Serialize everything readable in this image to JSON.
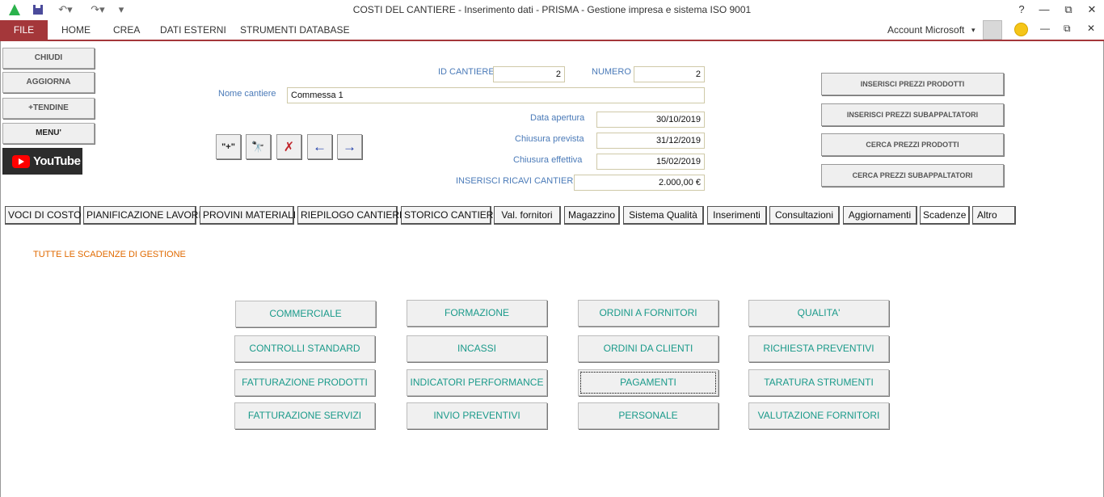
{
  "window": {
    "title": "COSTI DEL CANTIERE - Inserimento dati - PRISMA - Gestione impresa e sistema ISO 9001",
    "help": "?",
    "restore": "⧉",
    "minimize": "—",
    "close": "✕"
  },
  "ribbon": {
    "file": "FILE",
    "tabs": [
      "HOME",
      "CREA",
      "DATI ESTERNI",
      "STRUMENTI DATABASE"
    ],
    "account": "Account Microsoft"
  },
  "sidebar": {
    "close": "CHIUDI",
    "refresh": "AGGIORNA",
    "dropdowns": "+TENDINE",
    "menu": "MENU'",
    "youtube": "YouTube"
  },
  "fields": {
    "id_label": "ID CANTIERE",
    "id_value": "2",
    "numero_label": "NUMERO",
    "numero_value": "2",
    "nome_label": "Nome cantiere",
    "nome_value": "Commessa 1",
    "apertura_label": "Data apertura",
    "apertura_value": "30/10/2019",
    "prevista_label": "Chiusura prevista",
    "prevista_value": "31/12/2019",
    "effettiva_label": "Chiusura effettiva",
    "effettiva_value": "15/02/2019",
    "ricavi_label": "INSERISCI RICAVI CANTIERE",
    "ricavi_value": "2.000,00 €"
  },
  "nav": {
    "new": "\"+\"",
    "find": "🔭",
    "delete": "✗",
    "prev": "←",
    "next": "→"
  },
  "actions": {
    "ins_prodotti": "INSERISCI PREZZI PRODOTTI",
    "ins_subappalt": "INSERISCI PREZZI SUBAPPALTATORI",
    "cerca_prodotti": "CERCA PREZZI PRODOTTI",
    "cerca_subappalt": "CERCA PREZZI SUBAPPALTATORI"
  },
  "tabs": [
    "VOCI DI COSTO",
    "PIANIFICAZIONE LAVORI",
    "PROVINI MATERIALI",
    "RIEPILOGO CANTIERE",
    "STORICO CANTIERI",
    "Val. fornitori",
    "Magazzino",
    "Sistema Qualità",
    "Inserimenti",
    "Consultazioni",
    "Aggiornamenti",
    "Scadenze",
    "Altro"
  ],
  "section_title": "TUTTE LE SCADENZE DI GESTIONE",
  "grid": [
    "COMMERCIALE",
    "FORMAZIONE",
    "ORDINI A FORNITORI",
    "QUALITA'",
    "CONTROLLI STANDARD",
    "INCASSI",
    "ORDINI DA CLIENTI",
    "RICHIESTA PREVENTIVI",
    "FATTURAZIONE PRODOTTI",
    "INDICATORI PERFORMANCE",
    "PAGAMENTI",
    "TARATURA STRUMENTI",
    "FATTURAZIONE SERVIZI",
    "INVIO PREVENTIVI",
    "PERSONALE",
    "VALUTAZIONE FORNITORI"
  ]
}
